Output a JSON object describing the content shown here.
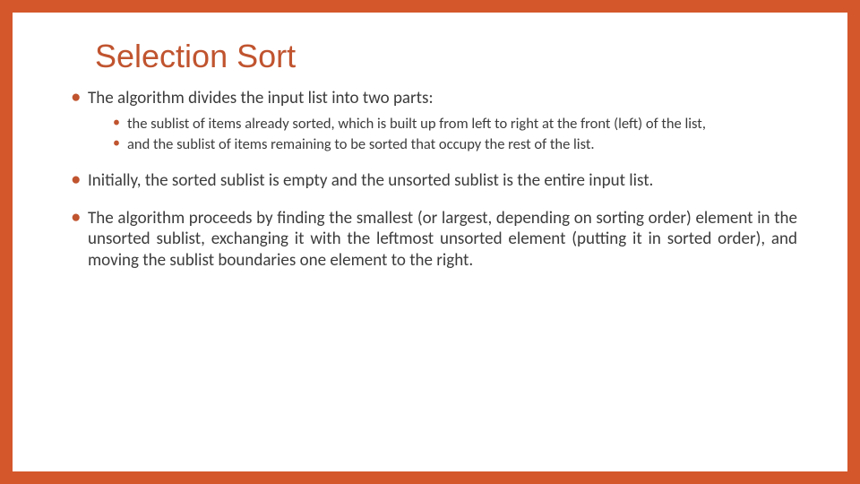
{
  "colors": {
    "accent": "#c0542f",
    "border": "#d4572b"
  },
  "title": "Selection Sort",
  "bullets": [
    {
      "text": "The algorithm divides the input list into two parts:",
      "sub": [
        " the sublist of items already sorted, which is built up from left to right at the front (left) of the list,",
        "and the sublist of items remaining to be sorted that occupy the rest of the list."
      ]
    },
    {
      "text": "Initially, the sorted sublist is empty and the unsorted sublist is the entire input list.",
      "sub": []
    },
    {
      "text": "The algorithm proceeds by finding the smallest (or largest, depending on sorting order) element in the unsorted sublist, exchanging it with the leftmost unsorted element (putting it in sorted order), and moving the sublist boundaries one element to the right.",
      "sub": []
    }
  ]
}
